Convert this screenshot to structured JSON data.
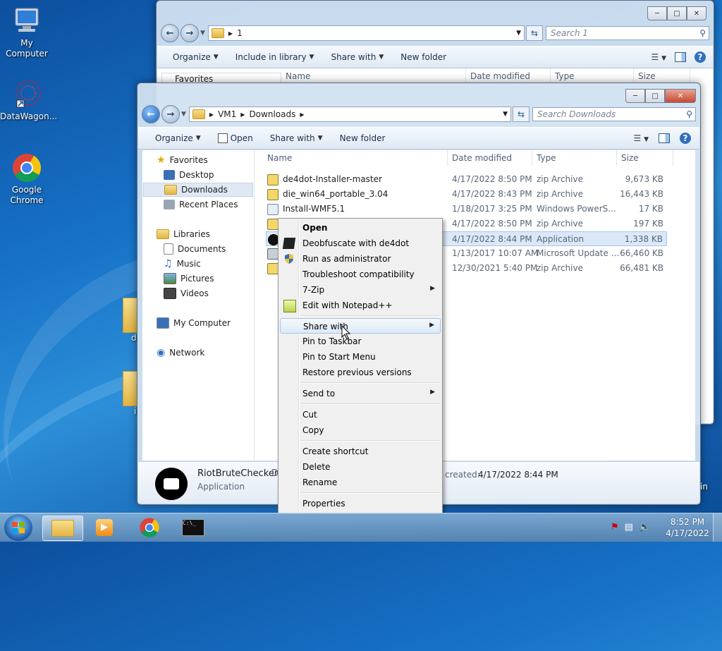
{
  "desktop": {
    "icons": [
      {
        "label": "My Computer"
      },
      {
        "label": "DataWagon..."
      },
      {
        "label": "Google Chrome"
      }
    ]
  },
  "back_window": {
    "address": "1",
    "search_placeholder": "Search 1",
    "toolbar": [
      "Organize",
      "Include in library",
      "Share with",
      "New folder"
    ],
    "columns": [
      "Name",
      "Date modified",
      "Type",
      "Size"
    ],
    "nav_first": "Favorites"
  },
  "front_window": {
    "breadcrumb": [
      "VM1",
      "Downloads"
    ],
    "search_placeholder": "Search Downloads",
    "toolbar": {
      "organize": "Organize",
      "open": "Open",
      "share_with": "Share with",
      "new_folder": "New folder"
    },
    "columns": {
      "name": "Name",
      "date": "Date modified",
      "type": "Type",
      "size": "Size"
    },
    "nav": {
      "favorites": "Favorites",
      "desktop": "Desktop",
      "downloads": "Downloads",
      "recent": "Recent Places",
      "libraries": "Libraries",
      "documents": "Documents",
      "music": "Music",
      "pictures": "Pictures",
      "videos": "Videos",
      "computer": "My Computer",
      "network": "Network"
    },
    "files": [
      {
        "name": "de4dot-Installer-master",
        "date": "4/17/2022 8:50 PM",
        "type": "zip Archive",
        "size": "9,673 KB"
      },
      {
        "name": "die_win64_portable_3.04",
        "date": "4/17/2022 8:43 PM",
        "type": "zip Archive",
        "size": "16,443 KB"
      },
      {
        "name": "Install-WMF5.1",
        "date": "1/18/2017 3:25 PM",
        "type": "Windows PowerS...",
        "size": "17 KB"
      },
      {
        "name": "",
        "date": "4/17/2022 8:50 PM",
        "type": "zip Archive",
        "size": "197 KB"
      },
      {
        "name": "",
        "date": "4/17/2022 8:44 PM",
        "type": "Application",
        "size": "1,338 KB"
      },
      {
        "name": "",
        "date": "1/13/2017 10:07 AM",
        "type": "Microsoft Update ...",
        "size": "66,460 KB"
      },
      {
        "name": "",
        "date": "12/30/2021 5:40 PM",
        "type": "zip Archive",
        "size": "66,481 KB"
      }
    ],
    "details": {
      "name": "RiotBruteChecker",
      "name_cut": "D",
      "type": "Application",
      "created": "created:",
      "created_value": "4/17/2022 8:44 PM"
    }
  },
  "context_menu": {
    "open": "Open",
    "deobfuscate": "Deobfuscate with de4dot",
    "run_admin": "Run as administrator",
    "troubleshoot": "Troubleshoot compatibility",
    "zip": "7-Zip",
    "notepad": "Edit with Notepad++",
    "share_with": "Share with",
    "pin_taskbar": "Pin to Taskbar",
    "pin_start": "Pin to Start Menu",
    "restore": "Restore previous versions",
    "send_to": "Send to",
    "cut": "Cut",
    "copy": "Copy",
    "create_shortcut": "Create shortcut",
    "delete": "Delete",
    "rename": "Rename",
    "properties": "Properties"
  },
  "taskbar": {
    "clock_time": "8:52 PM",
    "clock_date": "4/17/2022"
  },
  "edge_text": {
    "d": "d",
    "i": "i",
    "in": "in"
  }
}
